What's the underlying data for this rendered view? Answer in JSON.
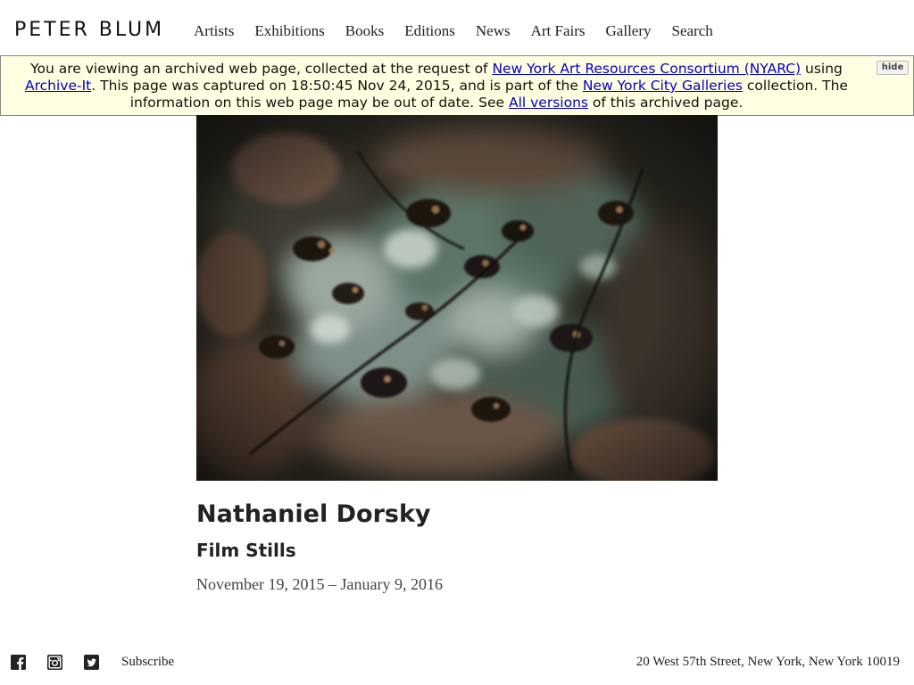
{
  "header": {
    "logo": "PETER BLUM",
    "nav": [
      "Artists",
      "Exhibitions",
      "Books",
      "Editions",
      "News",
      "Art Fairs",
      "Gallery",
      "Search"
    ]
  },
  "banner": {
    "t1": "You are viewing an archived web page, collected at the request of ",
    "link_nyarc": "New York Art Resources Consortium (NYARC)",
    "t2": " using ",
    "link_archive_it": "Archive-It",
    "t3": ". This page was captured on 18:50:45 Nov 24, 2015, and is part of the ",
    "link_collection": "New York City Galleries",
    "t4": " collection. The information on this web page may be out of date. See ",
    "link_versions": "All versions",
    "t5": " of this archived page.",
    "hide": "hide"
  },
  "exhibition": {
    "artist": "Nathaniel Dorsky",
    "title": "Film Stills",
    "dates": "November 19, 2015 – January 9, 2016"
  },
  "footer": {
    "social_icons": [
      "facebook-icon",
      "instagram-icon",
      "twitter-icon"
    ],
    "subscribe": "Subscribe",
    "address": "20 West 57th Street, New York, New York 10019"
  },
  "colors": {
    "banner_bg": "#ffffe1",
    "link": "#0000cc",
    "text": "#222222"
  }
}
